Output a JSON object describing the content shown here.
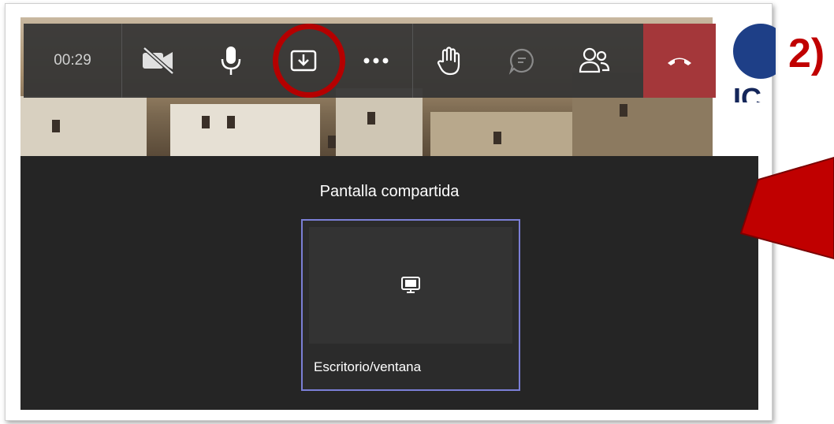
{
  "toolbar": {
    "timer": "00:29",
    "buttons": [
      {
        "icon": "camera-off-icon"
      },
      {
        "icon": "microphone-icon"
      },
      {
        "icon": "share-tray-icon"
      },
      {
        "icon": "more-options-icon"
      },
      {
        "icon": "raise-hand-icon"
      },
      {
        "icon": "chat-icon"
      },
      {
        "icon": "participants-icon"
      },
      {
        "icon": "hang-up-icon"
      }
    ]
  },
  "annotation": {
    "step_label": "2)",
    "highlight_color": "#b50000",
    "arrow_color": "#c00000"
  },
  "logo": {
    "text": "IC"
  },
  "share_panel": {
    "title": "Pantalla compartida",
    "option_label": "Escritorio/ventana",
    "option_icon": "monitor-icon"
  },
  "colors": {
    "toolbar_bg": "#343434",
    "hangup_bg": "#a4373a",
    "panel_bg": "#252525",
    "card_border": "#7b7fd6"
  }
}
